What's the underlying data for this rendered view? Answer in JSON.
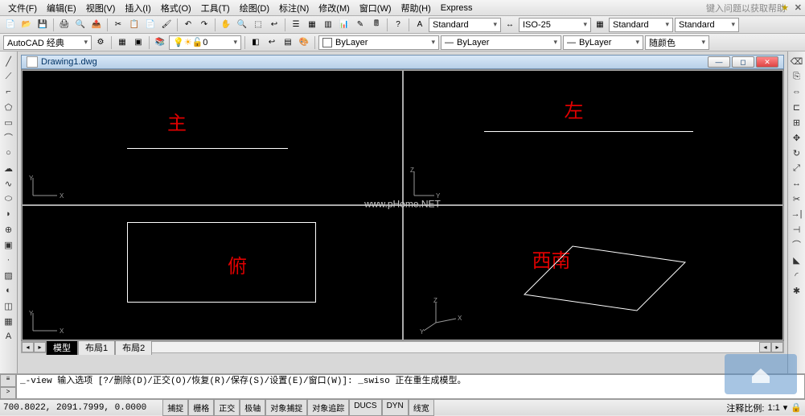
{
  "menu": {
    "items": [
      "文件(F)",
      "编辑(E)",
      "视图(V)",
      "插入(I)",
      "格式(O)",
      "工具(T)",
      "绘图(D)",
      "标注(N)",
      "修改(M)",
      "窗口(W)",
      "帮助(H)",
      "Express"
    ],
    "help_hint": "键入问题以获取帮助"
  },
  "toolbar1": {
    "style1": "Standard",
    "style2": "ISO-25",
    "style3": "Standard",
    "style4": "Standard"
  },
  "toolbar2": {
    "workspace": "AutoCAD 经典",
    "layer": "0",
    "bylayer1": "ByLayer",
    "bylayer2": "ByLayer",
    "bylayer3": "ByLayer",
    "color": "随颜色"
  },
  "document": {
    "title": "Drawing1.dwg"
  },
  "viewports": {
    "v1": {
      "label": "主"
    },
    "v2": {
      "label": "左"
    },
    "v3": {
      "label": "俯"
    },
    "v4": {
      "label": "西南"
    }
  },
  "watermark": "www.pHome.NET",
  "tabs": {
    "model": "模型",
    "layout1": "布局1",
    "layout2": "布局2"
  },
  "command": {
    "line1": "_-view 输入选项 [?/删除(D)/正交(O)/恢复(R)/保存(S)/设置(E)/窗口(W)]: _swiso 正在重生成模型。",
    "line2": ""
  },
  "status": {
    "coords": "700.8022, 2091.7999, 0.0000",
    "toggles": [
      "捕捉",
      "栅格",
      "正交",
      "极轴",
      "对象捕捉",
      "对象追踪",
      "DUCS",
      "DYN",
      "线宽"
    ],
    "annot": "注释比例:",
    "scale": "1:1"
  }
}
